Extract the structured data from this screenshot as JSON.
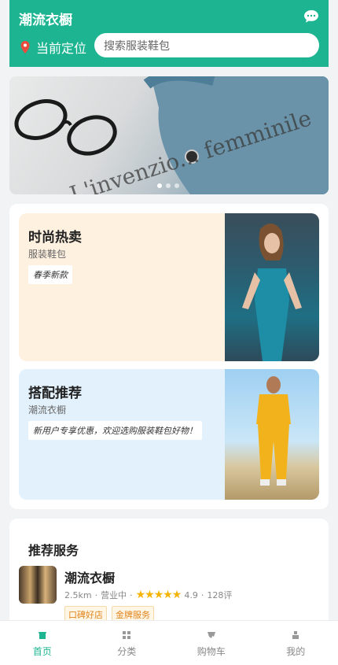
{
  "header": {
    "title": "潮流衣橱",
    "location_label": "当前定位",
    "search_placeholder": "搜索服装鞋包"
  },
  "banner": {
    "paper_text": "L'invenzio... femminile",
    "dots": 3,
    "active_dot": 0
  },
  "promos": [
    {
      "title": "时尚热卖",
      "subtitle": "服装鞋包",
      "tag": "春季新款"
    },
    {
      "title": "搭配推荐",
      "subtitle": "潮流衣橱",
      "tag": "新用户专享优惠，欢迎选购服装鞋包好物！"
    }
  ],
  "services": {
    "title": "推荐服务",
    "shop": {
      "name": "潮流衣橱",
      "distance": "2.5km",
      "status": "营业中",
      "stars": "★★★★★",
      "rating": "4.9",
      "reviews": "128评",
      "badges": [
        "口碑好店",
        "金牌服务"
      ]
    }
  },
  "tabbar": [
    {
      "label": "首页",
      "icon": "home-icon",
      "active": true
    },
    {
      "label": "分类",
      "icon": "grid-icon",
      "active": false
    },
    {
      "label": "购物车",
      "icon": "cart-icon",
      "active": false
    },
    {
      "label": "我的",
      "icon": "user-icon",
      "active": false
    }
  ],
  "colors": {
    "brand": "#1db591",
    "star": "#f5b301",
    "badge_text": "#e0851c"
  }
}
